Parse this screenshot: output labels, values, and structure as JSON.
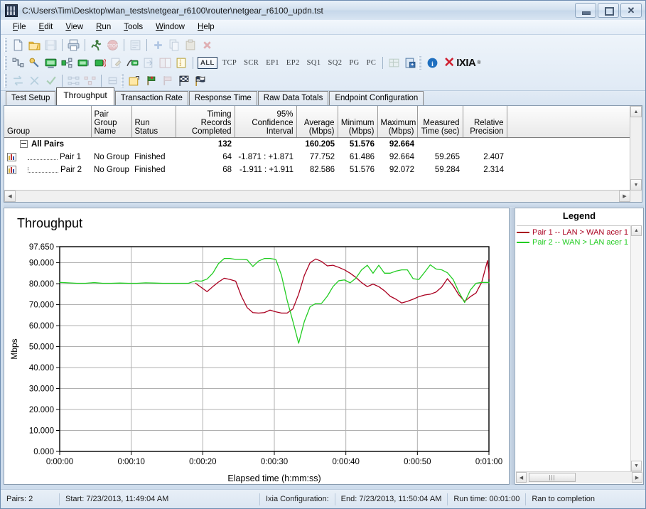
{
  "window": {
    "title": "C:\\Users\\Tim\\Desktop\\wlan_tests\\netgear_r6100\\router\\netgear_r6100_updn.tst",
    "app_icon": "ixchariot-icon",
    "minimize": "–",
    "maximize": "▭",
    "close": "✕"
  },
  "menu": [
    {
      "label": "File"
    },
    {
      "label": "Edit"
    },
    {
      "label": "View"
    },
    {
      "label": "Run"
    },
    {
      "label": "Tools"
    },
    {
      "label": "Window"
    },
    {
      "label": "Help"
    }
  ],
  "toolbar": {
    "filter_buttons": [
      "ALL",
      "TCP",
      "SCR",
      "EP1",
      "EP2",
      "SQ1",
      "SQ2",
      "PG",
      "PC"
    ],
    "active_filter": "ALL",
    "brand_x": "✕",
    "brand_name": "IXIA",
    "brand_tm": "®"
  },
  "tabs": [
    {
      "label": "Test Setup",
      "selected": false
    },
    {
      "label": "Throughput",
      "selected": true
    },
    {
      "label": "Transaction Rate",
      "selected": false
    },
    {
      "label": "Response Time",
      "selected": false
    },
    {
      "label": "Raw Data Totals",
      "selected": false
    },
    {
      "label": "Endpoint Configuration",
      "selected": false
    }
  ],
  "table": {
    "headers": [
      "Group",
      "Pair Group\nName",
      "Run Status",
      "Timing Records\nCompleted",
      "95% Confidence\nInterval",
      "Average\n(Mbps)",
      "Minimum\n(Mbps)",
      "Maximum\n(Mbps)",
      "Measured\nTime (sec)",
      "Relative\nPrecision"
    ],
    "rows": [
      {
        "type": "group",
        "group": "All Pairs",
        "pair_group_name": "",
        "run_status": "",
        "timing_records": "132",
        "confidence_interval": "",
        "average": "160.205",
        "minimum": "51.576",
        "maximum": "92.664",
        "measured_time": "",
        "relative_precision": ""
      },
      {
        "type": "pair",
        "group": "Pair 1",
        "pair_group_name": "No Group",
        "run_status": "Finished",
        "timing_records": "64",
        "confidence_interval": "-1.871 : +1.871",
        "average": "77.752",
        "minimum": "61.486",
        "maximum": "92.664",
        "measured_time": "59.265",
        "relative_precision": "2.407"
      },
      {
        "type": "pair",
        "group": "Pair 2",
        "pair_group_name": "No Group",
        "run_status": "Finished",
        "timing_records": "68",
        "confidence_interval": "-1.911 : +1.911",
        "average": "82.586",
        "minimum": "51.576",
        "maximum": "92.072",
        "measured_time": "59.284",
        "relative_precision": "2.314"
      }
    ]
  },
  "legend": {
    "title": "Legend",
    "entries": [
      {
        "label": "Pair 1 -- LAN > WAN acer 1",
        "color": "#aa0020"
      },
      {
        "label": "Pair 2 -- WAN > LAN acer 1",
        "color": "#22cc22"
      }
    ]
  },
  "statusbar": {
    "pairs": "Pairs: 2",
    "start": "Start: 7/23/2013, 11:49:04 AM",
    "configuration": "Ixia Configuration:",
    "end": "End: 7/23/2013, 11:50:04 AM",
    "runtime": "Run time: 00:01:00",
    "result": "Ran to completion"
  },
  "chart_data": {
    "type": "line",
    "title": "Throughput",
    "xlabel": "Elapsed time (h:mm:ss)",
    "ylabel": "Mbps",
    "ylim": [
      0,
      97.65
    ],
    "xlim": [
      0,
      60
    ],
    "grid": true,
    "legend_position": "right-panel",
    "yticks": [
      "0.000",
      "10.000",
      "20.000",
      "30.000",
      "40.000",
      "50.000",
      "60.000",
      "70.000",
      "80.000",
      "90.000",
      "97.650"
    ],
    "ytick_values": [
      0,
      10,
      20,
      30,
      40,
      50,
      60,
      70,
      80,
      90,
      97.65
    ],
    "xticks": [
      "0:00:00",
      "0:00:10",
      "0:00:20",
      "0:00:30",
      "0:00:40",
      "0:00:50",
      "0:01:00"
    ],
    "xtick_values": [
      0,
      10,
      20,
      30,
      40,
      50,
      60
    ],
    "series": [
      {
        "name": "Pair 1 -- LAN > WAN acer 1",
        "color": "#aa0020",
        "x": [
          19.0,
          19.8,
          20.6,
          21.4,
          22.2,
          23.0,
          23.8,
          24.6,
          25.4,
          26.2,
          27.0,
          27.8,
          28.6,
          29.4,
          30.2,
          31.0,
          31.8,
          32.6,
          33.4,
          34.2,
          35.0,
          35.8,
          36.6,
          37.4,
          38.2,
          39.0,
          39.8,
          40.6,
          41.4,
          42.2,
          43.0,
          43.8,
          44.6,
          45.4,
          46.2,
          47.0,
          47.8,
          48.6,
          49.4,
          50.2,
          51.0,
          51.8,
          52.6,
          53.4,
          54.2,
          55.0,
          55.8,
          56.6,
          57.4,
          58.2,
          59.0,
          59.8
        ],
        "y": [
          80.2,
          78.2,
          76.2,
          78.6,
          80.8,
          82.6,
          82.0,
          81.2,
          74.0,
          68.6,
          66.2,
          66.0,
          66.2,
          67.4,
          66.6,
          66.0,
          66.0,
          68.0,
          75.0,
          84.0,
          90.0,
          91.8,
          90.6,
          88.5,
          88.8,
          87.8,
          86.6,
          85.0,
          83.0,
          80.5,
          78.6,
          79.8,
          78.6,
          76.6,
          74.0,
          72.6,
          70.8,
          71.6,
          72.6,
          73.8,
          74.6,
          75.0,
          76.0,
          78.4,
          82.4,
          79.0,
          74.6,
          71.6,
          73.8,
          75.6,
          80.8,
          91.0
        ],
        "y_tail": [
          85.0,
          83.2,
          82.6,
          82.4
        ]
      },
      {
        "name": "Pair 2 -- WAN > LAN acer 1",
        "color": "#22cc22",
        "x": [
          0.0,
          1.2,
          2.4,
          3.6,
          4.8,
          6.0,
          7.2,
          8.4,
          9.6,
          10.8,
          12.0,
          13.2,
          14.4,
          15.6,
          16.8,
          18.0,
          19.0,
          19.8,
          20.6,
          21.4,
          22.2,
          23.0,
          23.8,
          24.6,
          25.4,
          26.2,
          27.0,
          27.8,
          28.6,
          29.4,
          30.2,
          31.0,
          31.8,
          32.6,
          33.4,
          34.2,
          35.0,
          35.8,
          36.6,
          37.4,
          38.2,
          39.0,
          39.8,
          40.6,
          41.4,
          42.2,
          43.0,
          43.8,
          44.6,
          45.4,
          46.2,
          47.0,
          47.8,
          48.6,
          49.4,
          50.2,
          51.0,
          51.8,
          52.6,
          53.4,
          54.2,
          55.0,
          55.8,
          56.6,
          57.4,
          58.2,
          59.0,
          59.8
        ],
        "y": [
          80.6,
          80.4,
          80.2,
          80.2,
          80.5,
          80.2,
          80.2,
          80.3,
          80.2,
          80.2,
          80.4,
          80.3,
          80.2,
          80.2,
          80.2,
          80.2,
          81.4,
          81.2,
          82.2,
          85.0,
          89.6,
          92.0,
          92.0,
          91.6,
          91.6,
          91.4,
          88.2,
          90.8,
          92.0,
          92.0,
          91.6,
          84.0,
          72.0,
          62.0,
          51.6,
          62.0,
          69.0,
          70.6,
          70.6,
          74.0,
          78.6,
          81.4,
          81.8,
          80.4,
          82.6,
          86.6,
          88.8,
          85.0,
          88.8,
          85.0,
          85.0,
          86.0,
          86.6,
          86.6,
          82.4,
          82.0,
          85.4,
          89.0,
          87.0,
          86.6,
          85.2,
          82.0,
          76.0,
          71.0,
          77.0,
          80.2,
          80.6,
          80.6
        ],
        "y_tail": [
          80.6,
          80.4,
          80.4,
          80.4
        ]
      }
    ]
  }
}
